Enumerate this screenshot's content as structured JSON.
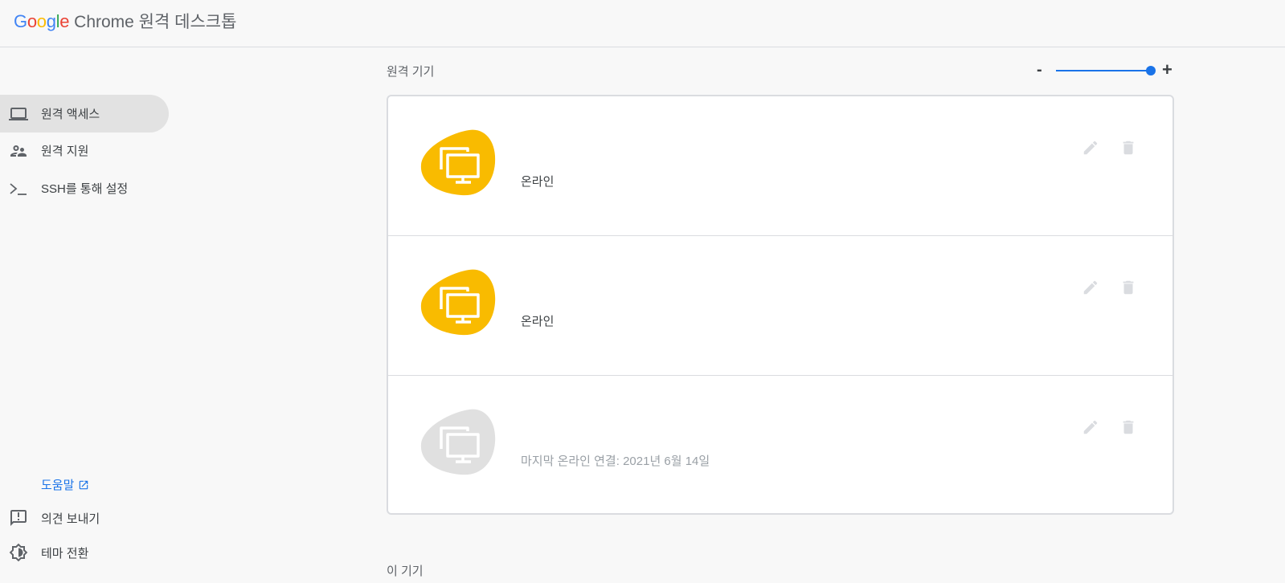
{
  "header": {
    "logo": {
      "letters": [
        "G",
        "o",
        "o",
        "g",
        "l",
        "e"
      ]
    },
    "product_name": "Chrome 원격 데스크톱"
  },
  "sidebar": {
    "items": [
      {
        "label": "원격 액세스",
        "icon": "laptop-icon",
        "active": true
      },
      {
        "label": "원격 지원",
        "icon": "people-icon",
        "active": false
      },
      {
        "label": "SSH를 통해 설정",
        "icon": "terminal-icon",
        "active": false
      }
    ],
    "help": {
      "label": "도움말",
      "icon": "open-in-new-icon"
    },
    "feedback": {
      "label": "의견 보내기",
      "icon": "feedback-icon"
    },
    "theme": {
      "label": "테마 전환",
      "icon": "brightness-icon"
    }
  },
  "main": {
    "remote_devices_title": "원격 기기",
    "zoom": {
      "minus_label": "-",
      "plus_label": "+",
      "level": 1.0
    },
    "devices": [
      {
        "name": "",
        "status": "온라인",
        "online": true,
        "avatar_icon": "computer-icon"
      },
      {
        "name": "",
        "status": "온라인",
        "online": true,
        "avatar_icon": "computer-icon"
      },
      {
        "name": "",
        "status": "마지막 온라인 연결: 2021년 6월 14일",
        "online": false,
        "avatar_icon": "computer-icon"
      }
    ],
    "this_device_title": "이 기기"
  },
  "colors": {
    "online_avatar": "#f9bb00",
    "offline_avatar": "#e0e0e0",
    "accent": "#1a73e8",
    "action_icon": "#dadce0"
  }
}
